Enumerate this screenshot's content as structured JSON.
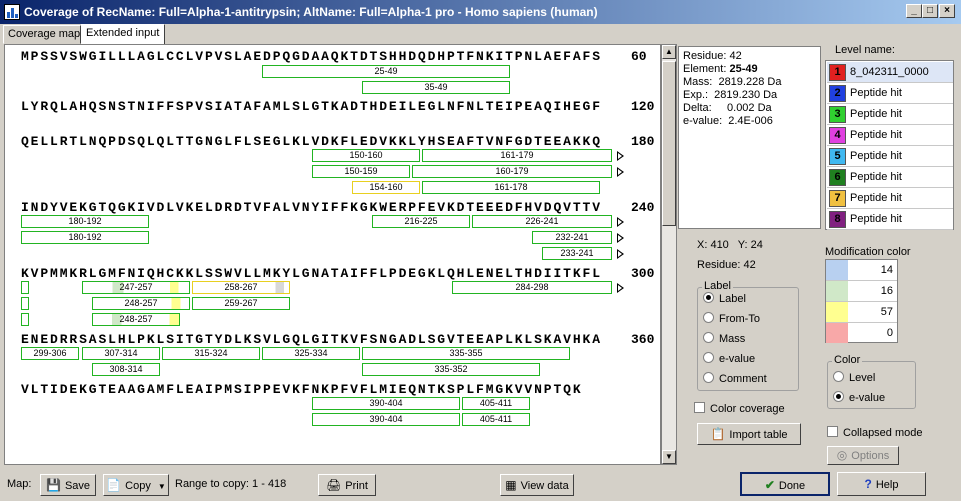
{
  "window": {
    "title": "Coverage of RecName: Full=Alpha-1-antitrypsin; AltName: Full=Alpha-1 pro - Homo sapiens (human)"
  },
  "tabs": [
    {
      "label": "Coverage map"
    },
    {
      "label": "Extended input"
    }
  ],
  "sequence": {
    "lines": [
      {
        "text": "MPSSVSWGILLLAGLCCLVPVSLAEDPQGDAAQKTDTSHHDQDHPTFNKITPNLAEFAFS",
        "end": "60"
      },
      {
        "text": "LYRQLAHQSNSTNIFFSPVSIATAFAMLSLGTKADTHDEILEGLNFNLTEIPEAQIHEGF",
        "end": "120"
      },
      {
        "text": "QELLRTLNQPDSQLQLTTGNGLFLSEGLKLVDKFLEDVKKLYHSEAFTVNFGDTEEAKKQ",
        "end": "180"
      },
      {
        "text": "INDYVEKGTQGKIVDLVKELDRDTVFALVNYIFFKGKWERPFEVKDTEEEDFHVDQVTTV",
        "end": "240"
      },
      {
        "text": "KVPMMKRLGMFNIQHCKKLSSWVLLMKYLGNATAIFFLPDEGKLQHLENELTHDIITKFL",
        "end": "300"
      },
      {
        "text": "ENEDRRSASLHLPKLSITGTYDLKSVLGQLGITKVFSNGADLSGVTEEAPLKLSKAVHKA",
        "end": "360"
      },
      {
        "text": "VLTIDEKGTEAAGAMFLEAIPMSIPPEVKFNKPFVFLMIEQNTKSPLFMGKVVNPTQK",
        "end": ""
      }
    ],
    "peptides": [
      {
        "label": "25-49"
      },
      {
        "label": "35-49"
      },
      {
        "label": "150-160"
      },
      {
        "label": "161-179"
      },
      {
        "label": "150-159"
      },
      {
        "label": "160-179"
      },
      {
        "label": "154-160"
      },
      {
        "label": "161-178"
      },
      {
        "label": "180-192"
      },
      {
        "label": "216-225"
      },
      {
        "label": "226-241"
      },
      {
        "label": "180-192"
      },
      {
        "label": "232-241"
      },
      {
        "label": "233-241"
      },
      {
        "label": "247-257"
      },
      {
        "label": "258-267"
      },
      {
        "label": "284-298"
      },
      {
        "label": "248-257"
      },
      {
        "label": "259-267"
      },
      {
        "label": "248-257"
      },
      {
        "label": "299-306"
      },
      {
        "label": "307-314"
      },
      {
        "label": "315-324"
      },
      {
        "label": "325-334"
      },
      {
        "label": "335-355"
      },
      {
        "label": "308-314"
      },
      {
        "label": "335-352"
      },
      {
        "label": "390-404"
      },
      {
        "label": "405-411"
      },
      {
        "label": "390-404"
      },
      {
        "label": "405-411"
      }
    ]
  },
  "info": {
    "residue": "Residue: 42",
    "element_label": "Element: ",
    "element_value": "25-49",
    "mass": "Mass:  2819.228 Da",
    "exp": "Exp.:  2819.230 Da",
    "delta": "Delta:     0.002 Da",
    "evalue": "e-value:  2.4E-006"
  },
  "levels": {
    "title": "Level name:",
    "items": [
      {
        "num": "1",
        "name": "8_042311_0000",
        "color": "#e02020"
      },
      {
        "num": "2",
        "name": "Peptide hit",
        "color": "#2040e0"
      },
      {
        "num": "3",
        "name": "Peptide hit",
        "color": "#30d030"
      },
      {
        "num": "4",
        "name": "Peptide hit",
        "color": "#e040e0"
      },
      {
        "num": "5",
        "name": "Peptide hit",
        "color": "#40b8f0"
      },
      {
        "num": "6",
        "name": "Peptide hit",
        "color": "#208020"
      },
      {
        "num": "7",
        "name": "Peptide hit",
        "color": "#f0c040"
      },
      {
        "num": "8",
        "name": "Peptide hit",
        "color": "#802080"
      }
    ]
  },
  "cursor": {
    "coords": "X: 410   Y: 24",
    "residue": "Residue: 42"
  },
  "label_group": {
    "title": "Label",
    "options": [
      {
        "label": "Label",
        "checked": true
      },
      {
        "label": "From-To",
        "checked": false
      },
      {
        "label": "Mass",
        "checked": false
      },
      {
        "label": "e-value",
        "checked": false
      },
      {
        "label": "Comment",
        "checked": false
      }
    ]
  },
  "modification": {
    "title": "Modification color",
    "rows": [
      {
        "color": "#b8d0f0",
        "value": "14"
      },
      {
        "color": "#d0e8c8",
        "value": "16"
      },
      {
        "color": "#ffff90",
        "value": "57"
      },
      {
        "color": "#f8a8a8",
        "value": "0"
      }
    ]
  },
  "color_group": {
    "title": "Color",
    "options": [
      {
        "label": "Level",
        "checked": false
      },
      {
        "label": "e-value",
        "checked": true
      }
    ]
  },
  "checkboxes": {
    "color_coverage": "Color coverage",
    "collapsed_mode": "Collapsed mode"
  },
  "buttons": {
    "import_table": "Import table",
    "options": "Options",
    "done": "Done",
    "help": "Help"
  },
  "bottom": {
    "map_label": "Map:",
    "save": "Save",
    "copy": "Copy",
    "range": "Range to copy: 1 - 418",
    "print": "Print",
    "view_data": "View data"
  }
}
